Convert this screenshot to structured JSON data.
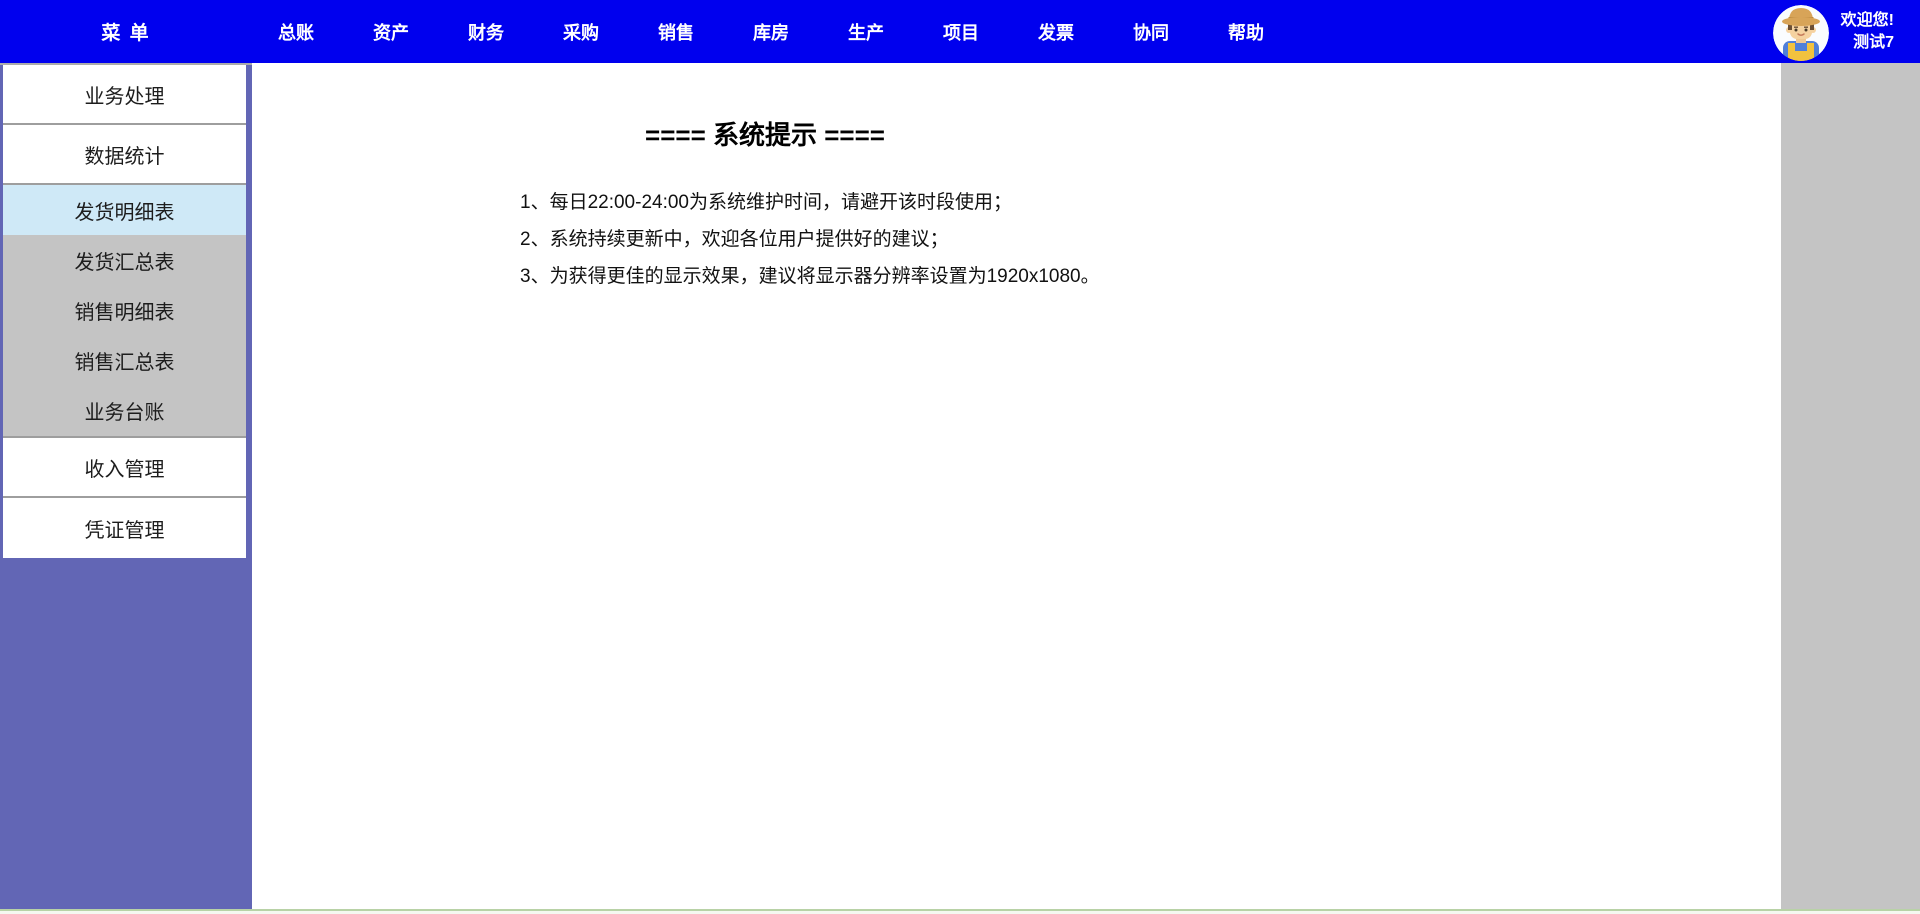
{
  "topbar": {
    "menu_label": "菜 单",
    "nav_items": [
      "总账",
      "资产",
      "财务",
      "采购",
      "销售",
      "库房",
      "生产",
      "项目",
      "发票",
      "协同",
      "帮助"
    ],
    "user": {
      "greeting": "欢迎您!",
      "username": "测试7"
    }
  },
  "sidebar": {
    "items": [
      {
        "label": "业务处理",
        "type": "group",
        "selected": false
      },
      {
        "label": "数据统计",
        "type": "group",
        "selected": false
      },
      {
        "label": "发货明细表",
        "type": "sub",
        "selected": true
      },
      {
        "label": "发货汇总表",
        "type": "sub",
        "selected": false
      },
      {
        "label": "销售明细表",
        "type": "sub",
        "selected": false
      },
      {
        "label": "销售汇总表",
        "type": "sub",
        "selected": false
      },
      {
        "label": "业务台账",
        "type": "sub",
        "selected": false
      },
      {
        "label": "收入管理",
        "type": "group",
        "selected": false
      },
      {
        "label": "凭证管理",
        "type": "group",
        "selected": false
      }
    ]
  },
  "main": {
    "title": "==== 系统提示 ====",
    "notices": [
      "1、每日22:00-24:00为系统维护时间，请避开该时段使用；",
      "2、系统持续更新中，欢迎各位用户提供好的建议；",
      "3、为获得更佳的显示效果，建议将显示器分辨率设置为1920x1080。"
    ]
  },
  "colors": {
    "topbar_bg": "#0000EE",
    "sidebar_purple": "#6266B5",
    "selected_item_bg": "#CFE9F7",
    "sub_item_bg": "#C4C4C4",
    "right_panel_bg": "#C4C4C4",
    "bottom_strip_border": "#B8D2A6"
  },
  "icons": {
    "avatar": "farmer-avatar-icon"
  }
}
